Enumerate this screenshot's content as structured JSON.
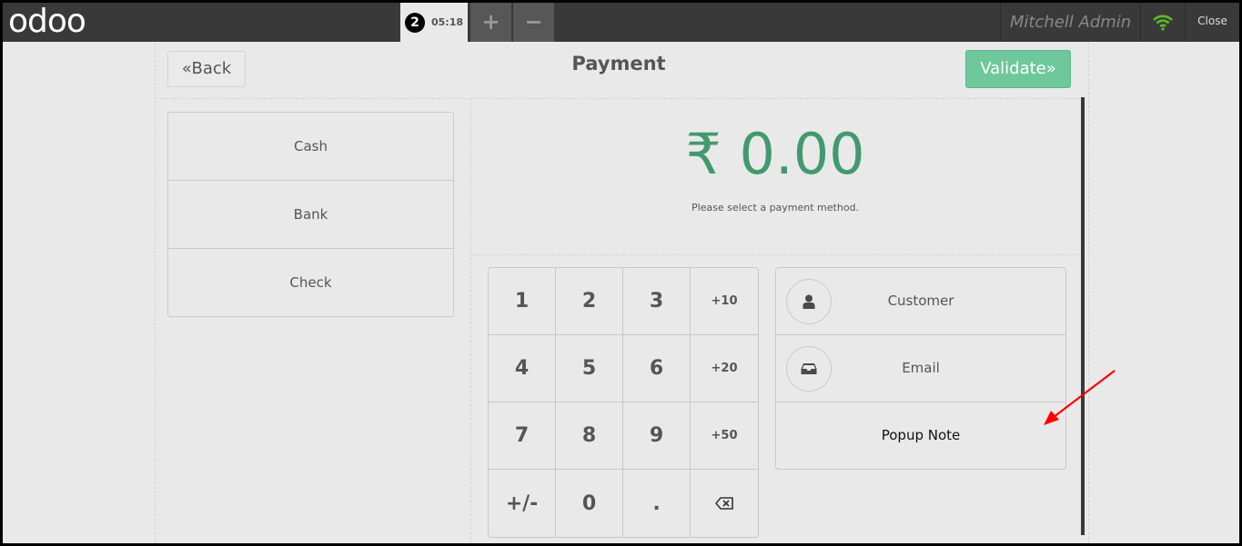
{
  "header": {
    "logo": "odoo",
    "order": {
      "number": "2",
      "time": "05:18"
    },
    "add_order_symbol": "+",
    "remove_order_symbol": "−",
    "username": "Mitchell Admin",
    "connection_icon": "wifi-icon",
    "connection_color": "#5cb82a",
    "close_label": "Close"
  },
  "payment": {
    "back_label": "Back",
    "back_icon": "«",
    "title": "Payment",
    "validate_label": "Validate",
    "validate_icon": "»",
    "validate_color": "#6ec89b",
    "methods": [
      {
        "label": "Cash"
      },
      {
        "label": "Bank"
      },
      {
        "label": "Check"
      }
    ],
    "amount": "₹ 0.00",
    "amount_color": "#43996e",
    "message": "Please select a payment method.",
    "numpad": [
      {
        "label": "1"
      },
      {
        "label": "2"
      },
      {
        "label": "3"
      },
      {
        "label": "+10"
      },
      {
        "label": "4"
      },
      {
        "label": "5"
      },
      {
        "label": "6"
      },
      {
        "label": "+20"
      },
      {
        "label": "7"
      },
      {
        "label": "8"
      },
      {
        "label": "9"
      },
      {
        "label": "+50"
      },
      {
        "label": "+/-"
      },
      {
        "label": "0"
      },
      {
        "label": "."
      },
      {
        "label": "backspace-icon"
      }
    ],
    "actions": [
      {
        "label": "Customer",
        "icon": "user-icon"
      },
      {
        "label": "Email",
        "icon": "inbox-icon"
      },
      {
        "label": "Popup Note",
        "icon": ""
      }
    ]
  },
  "annotation": {
    "type": "red-arrow",
    "color": "#ff0000",
    "points_to": "Popup Note"
  }
}
